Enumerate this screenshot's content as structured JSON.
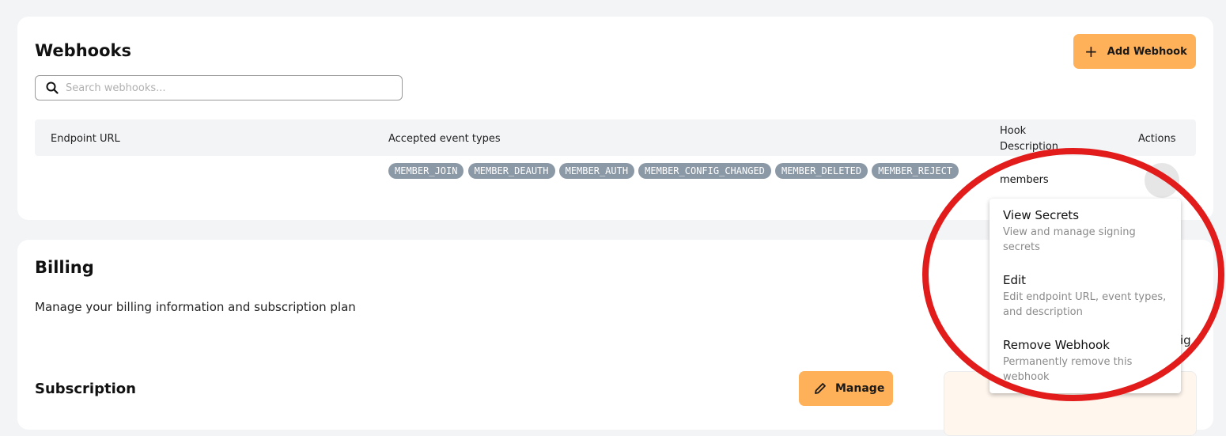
{
  "webhooks": {
    "title": "Webhooks",
    "add_button_label": "Add Webhook",
    "search": {
      "placeholder": "Search webhooks...",
      "value": ""
    },
    "table": {
      "headers": {
        "endpoint": "Endpoint URL",
        "events": "Accepted event types",
        "description": "Hook Description",
        "actions": "Actions"
      },
      "rows": [
        {
          "endpoint": "",
          "events": [
            "MEMBER_JOIN",
            "MEMBER_DEAUTH",
            "MEMBER_AUTH",
            "MEMBER_CONFIG_CHANGED",
            "MEMBER_DELETED",
            "MEMBER_REJECT"
          ],
          "description": "members"
        }
      ]
    }
  },
  "action_menu": {
    "items": [
      {
        "label": "View Secrets",
        "description": "View and manage signing secrets"
      },
      {
        "label": "Edit",
        "description": "Edit endpoint URL, event types, and description"
      },
      {
        "label": "Remove Webhook",
        "description": "Permanently remove this webhook"
      }
    ]
  },
  "billing": {
    "title": "Billing",
    "subtitle": "Manage your billing information and subscription plan",
    "subscription_title": "Subscription",
    "manage_button_label": "Manage",
    "cutoff_text": "ig"
  },
  "icons": {
    "search": "search-icon",
    "add": "plus-icon",
    "manage": "pencil-icon"
  },
  "colors": {
    "accent": "#ffb15a",
    "chip": "#8b98a6",
    "annotation": "#e21b1b",
    "background": "#f3f4f6"
  }
}
